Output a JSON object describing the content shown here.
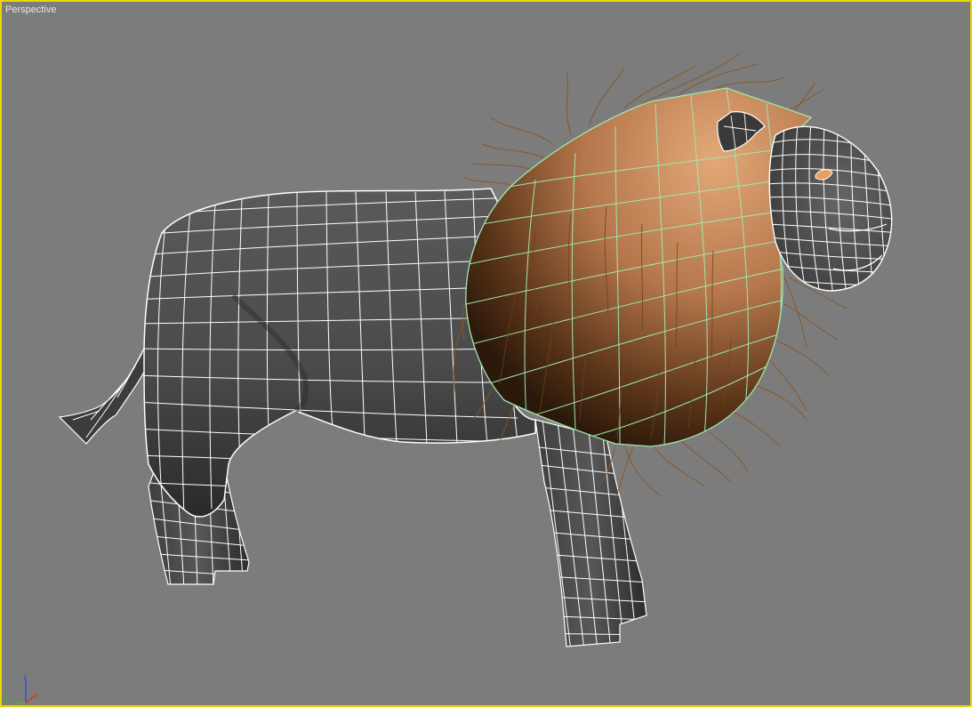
{
  "viewport": {
    "label": "Perspective",
    "border_color": "#e8d800",
    "background": "#7c7c7c"
  },
  "model": {
    "subject": "lion",
    "body_color": "#4a4a4a",
    "wire_color": "#ffffff",
    "mane_color": "#a86a3c",
    "mane_wire_color": "#9fe8b0",
    "hair_color": "#8a5424"
  },
  "axis_gizmo": {
    "x_label": "x",
    "y_label": "y",
    "z_label": "z",
    "x_color": "#e03030",
    "y_color": "#30c030",
    "z_color": "#3050e0"
  }
}
